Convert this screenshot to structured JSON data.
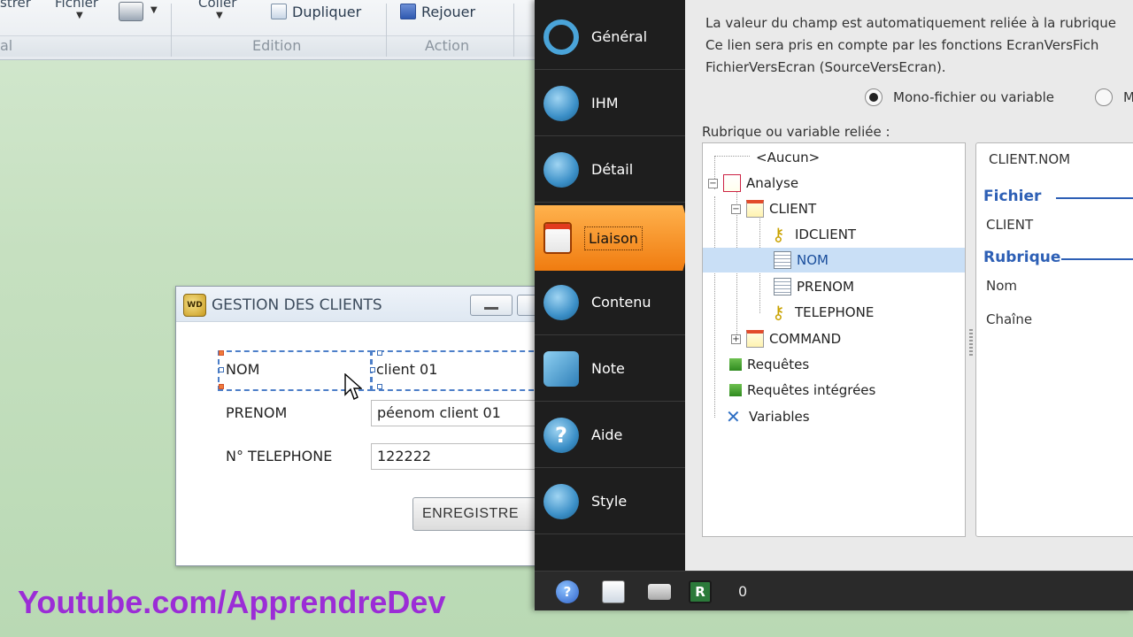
{
  "ribbon": {
    "cut_left_1": "strer",
    "cut_left_2": "Fichier",
    "cut_mid": "Coller",
    "duplicate_label": "Dupliquer",
    "replay_label": "Rejouer",
    "group_left": "al",
    "group_edition": "Edition",
    "group_action": "Action"
  },
  "client_window": {
    "title": "GESTION DES CLIENTS",
    "fields": [
      {
        "label": "NOM",
        "value": "client 01"
      },
      {
        "label": "PRENOM",
        "value": "péenom client 01"
      },
      {
        "label": "N° TELEPHONE",
        "value": "122222"
      }
    ],
    "save_button": "ENREGISTRE"
  },
  "watermark": "Youtube.com/ApprendreDev",
  "dialog": {
    "nav": [
      {
        "label": "Général",
        "icon": "ring-icon"
      },
      {
        "label": "IHM",
        "icon": "eye-icon"
      },
      {
        "label": "Détail",
        "icon": "detail-icon"
      },
      {
        "label": "Liaison",
        "icon": "file-link-icon",
        "active": true
      },
      {
        "label": "Contenu",
        "icon": "flask-icon"
      },
      {
        "label": "Note",
        "icon": "note-icon"
      },
      {
        "label": "Aide",
        "icon": "help-icon"
      },
      {
        "label": "Style",
        "icon": "style-icon"
      }
    ],
    "description": {
      "line1": "La valeur du champ est automatiquement reliée à la rubrique",
      "line2": "Ce lien sera pris en compte par les fonctions EcranVersFich",
      "line3": "FichierVersEcran (SourceVersEcran)."
    },
    "radio_mono": "Mono-fichier ou variable",
    "radio_multi": "M",
    "tree_label": "Rubrique ou variable reliée :",
    "tree": {
      "none": "<Aucun>",
      "analyse": "Analyse",
      "client": "CLIENT",
      "idclient": "IDCLIENT",
      "nom": "NOM",
      "prenom": "PRENOM",
      "telephone": "TELEPHONE",
      "command": "COMMAND",
      "requetes": "Requêtes",
      "requetes_integrees": "Requêtes intégrées",
      "variables": "Variables"
    },
    "info": {
      "binding": "CLIENT.NOM",
      "file_section": "Fichier",
      "file_value": "CLIENT",
      "field_section": "Rubrique",
      "field_name": "Nom",
      "field_type": "Chaîne"
    },
    "status_count": "0"
  }
}
